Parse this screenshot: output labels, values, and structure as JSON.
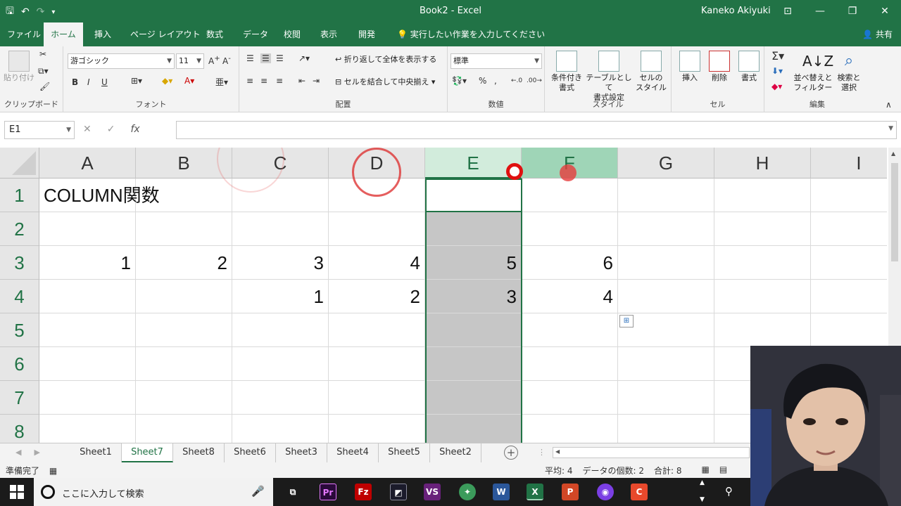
{
  "window": {
    "title": "Book2  -  Excel",
    "user": "Kaneko Akiyuki"
  },
  "tabs": [
    {
      "label": "ファイル",
      "active": false
    },
    {
      "label": "ホーム",
      "active": true
    },
    {
      "label": "挿入",
      "active": false
    },
    {
      "label": "ページ レイアウト",
      "active": false
    },
    {
      "label": "数式",
      "active": false
    },
    {
      "label": "データ",
      "active": false
    },
    {
      "label": "校閲",
      "active": false
    },
    {
      "label": "表示",
      "active": false
    },
    {
      "label": "開発",
      "active": false
    },
    {
      "label": "実行したい作業を入力してください",
      "active": false
    }
  ],
  "share_label": "共有",
  "ribbon": {
    "clipboard": {
      "paste": "貼り付け",
      "group": "クリップボード"
    },
    "font": {
      "name": "游ゴシック",
      "size": "11",
      "bold": "B",
      "italic": "I",
      "underline": "U",
      "group": "フォント"
    },
    "alignment": {
      "wrap": "折り返して全体を表示する",
      "merge": "セルを結合して中央揃え",
      "group": "配置"
    },
    "number": {
      "format": "標準",
      "percent": "%",
      "comma": ",",
      "group": "数値"
    },
    "styles": {
      "conditional": "条件付き\n書式",
      "table": "テーブルとして\n書式設定",
      "cell": "セルの\nスタイル",
      "group": "スタイル"
    },
    "cells": {
      "insert": "挿入",
      "delete": "削除",
      "format": "書式",
      "group": "セル"
    },
    "editing": {
      "sort": "並べ替えと\nフィルター",
      "find": "検索と\n選択",
      "group": "編集"
    }
  },
  "formula": {
    "name_box": "E1",
    "value": ""
  },
  "grid": {
    "columns": [
      "A",
      "B",
      "C",
      "D",
      "E",
      "F",
      "G",
      "H",
      "I"
    ],
    "rows": [
      "1",
      "2",
      "3",
      "4",
      "5",
      "6",
      "7",
      "8"
    ],
    "cells": {
      "A1": "COLUMN関数",
      "A3": "1",
      "B3": "2",
      "C3": "3",
      "D3": "4",
      "E3": "5",
      "F3": "6",
      "C4": "1",
      "D4": "2",
      "E4": "3",
      "F4": "4"
    }
  },
  "sheets": [
    {
      "name": "Sheet1",
      "active": false
    },
    {
      "name": "Sheet7",
      "active": true
    },
    {
      "name": "Sheet8",
      "active": false
    },
    {
      "name": "Sheet6",
      "active": false
    },
    {
      "name": "Sheet3",
      "active": false
    },
    {
      "name": "Sheet4",
      "active": false
    },
    {
      "name": "Sheet5",
      "active": false
    },
    {
      "name": "Sheet2",
      "active": false
    }
  ],
  "status": {
    "ready": "準備完了",
    "average": "平均: 4",
    "count": "データの個数: 2",
    "sum": "合計: 8"
  },
  "taskbar": {
    "search_placeholder": "ここに入力して検索"
  },
  "colors": {
    "excel_green": "#217346",
    "selection_fill": "#c6c6c6"
  }
}
